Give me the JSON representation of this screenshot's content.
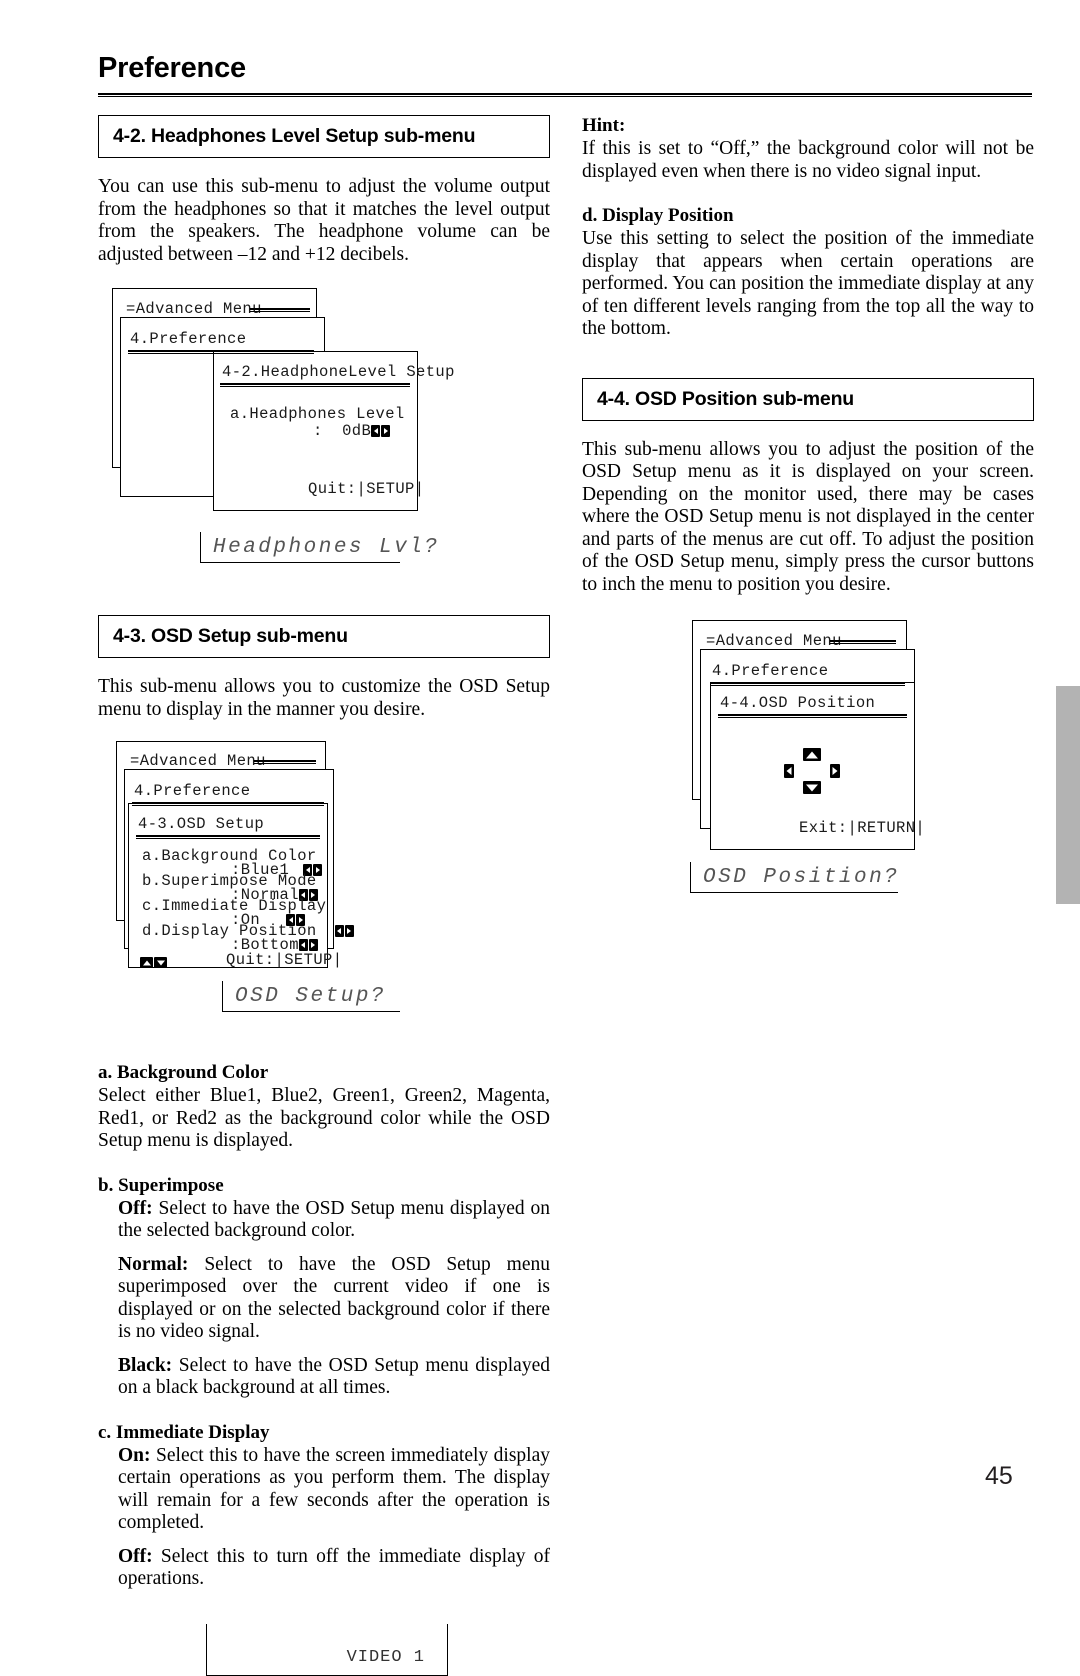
{
  "page": {
    "title": "Preference",
    "number": "45"
  },
  "left_column": {
    "section_4_2": {
      "heading": "4-2. Headphones Level Setup sub-menu",
      "body": "You can use this sub-menu to adjust the volume output from the headphones so that it matches the level output from the speakers. The headphone volume can be adjusted between –12 and +12 decibels.",
      "menu": {
        "back_title": "=Advanced Menu",
        "mid_title": "4.Preference",
        "front_title": "4-2.HeadphoneLevel Setup",
        "item_label": "a.Headphones Level",
        "item_value": ":  0dB",
        "footer": "Quit:|SETUP|"
      },
      "display": "Headphones Lvl?"
    },
    "section_4_3": {
      "heading": "4-3.  OSD Setup sub-menu",
      "body": "This sub-menu allows you to customize the OSD Setup menu to display in the manner you desire.",
      "menu": {
        "back_title": "=Advanced Menu",
        "mid_title": "4.Preference",
        "front_title": "4-3.OSD Setup",
        "rows": [
          {
            "label": "a.Background Color",
            "value": ":Blue1"
          },
          {
            "label": "b.Superimpose Mode",
            "value": ":Normal"
          },
          {
            "label": "c.Immediate Display",
            "value": ":On"
          },
          {
            "label": "d.Display Position",
            "value": ":Bottom"
          }
        ],
        "footer": "Quit:|SETUP|"
      },
      "display": "OSD Setup?"
    },
    "notes": {
      "a_heading": "a. Background Color",
      "a_body": "Select either Blue1, Blue2, Green1, Green2, Magenta, Red1, or Red2 as the background color while the OSD Setup menu is displayed.",
      "b_heading": "b. Superimpose",
      "b_off_label": "Off:",
      "b_off_body": " Select to have the OSD Setup menu displayed on the selected background color.",
      "b_normal_label": "Normal:",
      "b_normal_body": " Select to have the OSD Setup menu superimposed over the current video if one is displayed or on the selected background color if there is no video signal.",
      "b_black_label": "Black:",
      "b_black_body": " Select to have the OSD Setup menu displayed on a black background at all times.",
      "c_heading": "c. Immediate Display",
      "c_on_label": "On:",
      "c_on_body": " Select this to have the screen immediately display certain operations as you perform them. The display will remain for a few seconds after the operation is completed.",
      "c_off_label": "Off:",
      "c_off_body": " Select this to turn off the immediate display of operations."
    },
    "video_box": "VIDEO 1"
  },
  "right_column": {
    "hint_heading": "Hint:",
    "hint_body": "If this is set to “Off,” the background color will not be displayed even when there is no video signal input.",
    "d_heading": "d. Display Position",
    "d_body": "Use this setting to select the position of the immediate display that appears when certain operations are performed. You can position the immediate display at any of ten different levels ranging from the top all the way to the bottom.",
    "section_4_4": {
      "heading": "4-4.  OSD Position sub-menu",
      "body": "This sub-menu allows you to adjust the position of the OSD Setup menu as it is displayed on your screen. Depending on the monitor used, there may be cases where the OSD Setup menu is not displayed in the center and parts of the menus are cut off. To adjust the position of the OSD Setup menu, simply press the cursor buttons to inch the menu to position you desire.",
      "menu": {
        "back_title": "=Advanced Menu",
        "mid_title": "4.Preference",
        "front_title": "4-4.OSD Position",
        "footer": "Exit:|RETURN|"
      },
      "display": "OSD Position?"
    }
  },
  "icons": {
    "left_arrow": "left-arrow-button",
    "right_arrow": "right-arrow-button",
    "up_arrow": "up-arrow-button",
    "down_arrow": "down-arrow-button",
    "cursor_pad": "cursor-pad"
  }
}
